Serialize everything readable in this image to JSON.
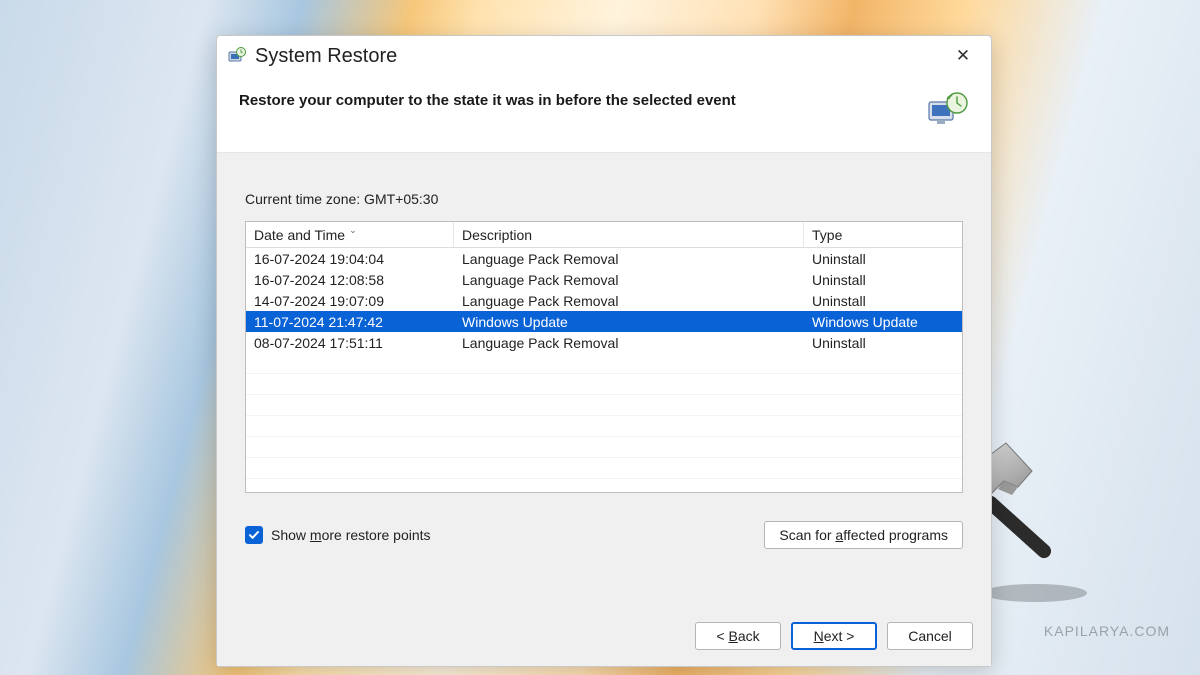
{
  "window": {
    "title": "System Restore",
    "headline": "Restore your computer to the state it was in before the selected event",
    "timezone_label": "Current time zone: GMT+05:30"
  },
  "table": {
    "columns": {
      "datetime": "Date and Time",
      "description": "Description",
      "type": "Type"
    },
    "rows": [
      {
        "datetime": "16-07-2024 19:04:04",
        "description": "Language Pack Removal",
        "type": "Uninstall",
        "selected": false
      },
      {
        "datetime": "16-07-2024 12:08:58",
        "description": "Language Pack Removal",
        "type": "Uninstall",
        "selected": false
      },
      {
        "datetime": "14-07-2024 19:07:09",
        "description": "Language Pack Removal",
        "type": "Uninstall",
        "selected": false
      },
      {
        "datetime": "11-07-2024 21:47:42",
        "description": "Windows Update",
        "type": "Windows Update",
        "selected": true
      },
      {
        "datetime": "08-07-2024 17:51:11",
        "description": "Language Pack Removal",
        "type": "Uninstall",
        "selected": false
      }
    ]
  },
  "controls": {
    "show_more_prefix": "Show ",
    "show_more_u": "m",
    "show_more_suffix": "ore restore points",
    "show_more_checked": true,
    "scan_prefix": "Scan for ",
    "scan_u": "a",
    "scan_suffix": "ffected programs",
    "back_prefix": "< ",
    "back_u": "B",
    "back_suffix": "ack",
    "next_u": "N",
    "next_suffix": "ext >",
    "cancel": "Cancel"
  },
  "watermark": "KAPILARYA.COM"
}
